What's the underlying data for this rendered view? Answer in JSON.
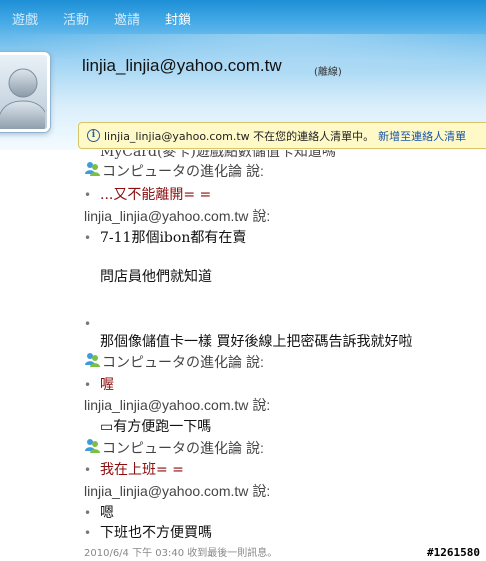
{
  "menu": {
    "items": [
      "遊戲",
      "活動",
      "邀請",
      "封鎖"
    ]
  },
  "contact": {
    "email": "linjia_linjia@yahoo.com.tw",
    "status": "(離線)"
  },
  "infobar": {
    "text": "linjia_linjia@yahoo.com.tw 不在您的連絡人清單中。",
    "link": "新增至連絡人清單"
  },
  "conversation": {
    "clipped_line": "MyCard(麥卡)遊戲點數儲值卡知道嗎",
    "says": "說:",
    "entries": [
      {
        "sender": "コンピュータの進化論",
        "messages": [
          "...又不能離開= ="
        ]
      },
      {
        "sender": "linjia_linjia@yahoo.com.tw",
        "messages": [
          "7-11那個ibon都有在賣",
          "問店員他們就知道",
          "",
          "那個像儲值卡一樣 買好後線上把密碼告訴我就好啦"
        ]
      },
      {
        "sender": "コンピュータの進化論",
        "messages": [
          "喔"
        ]
      },
      {
        "sender": "linjia_linjia@yahoo.com.tw",
        "messages": [
          "▭有方便跑一下嗎"
        ]
      },
      {
        "sender": "コンピュータの進化論",
        "messages": [
          "我在上班= ="
        ]
      },
      {
        "sender": "linjia_linjia@yahoo.com.tw",
        "messages": [
          "嗯",
          "下班也不方便買嗎"
        ]
      }
    ],
    "timestamp": "2010/6/4 下午 03:40 收到最後一則訊息。"
  },
  "watermark": "#1261580",
  "colors": {
    "header_top": "#1e8fd6",
    "infobar_bg": "#fff9c8",
    "link": "#1a55a8",
    "self_message": "#8b0d0d"
  }
}
